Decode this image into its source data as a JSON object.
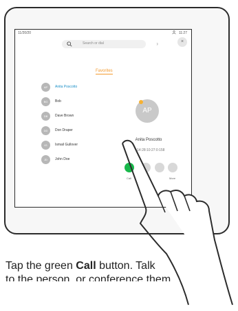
{
  "device": {
    "status_left": "11/20/20",
    "status_right": "11:27",
    "search": {
      "placeholder": "Search or dial"
    },
    "close_glyph": "×",
    "favorites_tab": "Favorites",
    "contacts": [
      {
        "initials": "AP",
        "name": "Anita Poscotto",
        "selected": true
      },
      {
        "initials": "BG",
        "name": "Bob",
        "selected": false
      },
      {
        "initials": "DB",
        "name": "Dave Brown",
        "selected": false
      },
      {
        "initials": "DD",
        "name": "Don Draper",
        "selected": false
      },
      {
        "initials": "IG",
        "name": "Ismail Gullover",
        "selected": false
      },
      {
        "initials": "JD",
        "name": "John Doe",
        "selected": false
      }
    ],
    "detail": {
      "initials": "AP",
      "name": "Anita Poscotto",
      "address": "11:14:28:10:27:0:158"
    },
    "actions": [
      {
        "label": "Call"
      },
      {
        "label": ""
      },
      {
        "label": ""
      },
      {
        "label": "More"
      }
    ],
    "colors": {
      "call_green": "#19b84b",
      "accent_orange": "#f39a2e",
      "selected_blue": "#1a8fc7"
    }
  },
  "caption": {
    "line1_before": "Tap the green ",
    "line1_bold": "Call",
    "line1_after": " button. Talk",
    "line2": "to the person, or conference them"
  }
}
